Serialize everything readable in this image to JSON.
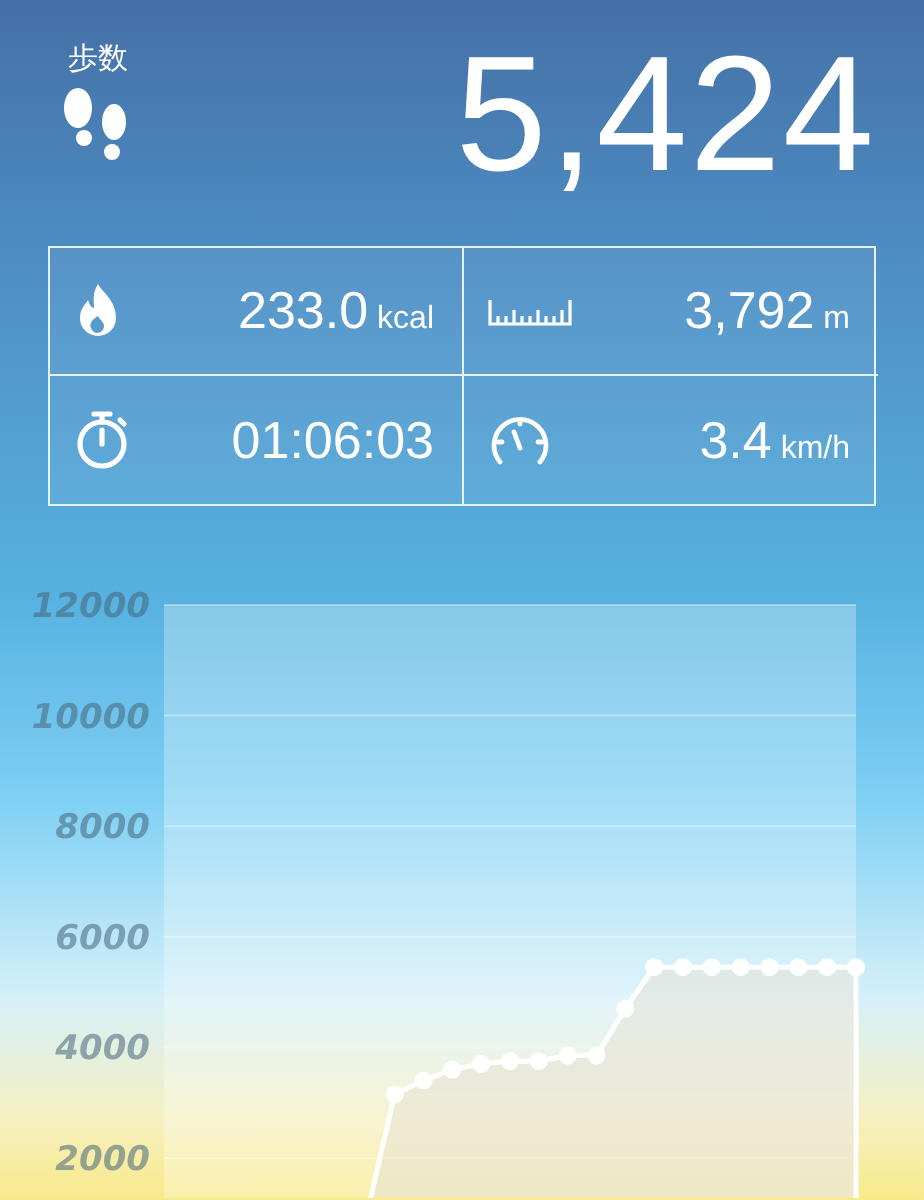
{
  "header": {
    "label": "歩数",
    "steps": "5,424"
  },
  "stats": [
    {
      "kind": "calories",
      "value": "233.0",
      "unit": "kcal"
    },
    {
      "kind": "distance",
      "value": "3,792",
      "unit": "m"
    },
    {
      "kind": "duration",
      "value": "01:06:03"
    },
    {
      "kind": "speed",
      "value": "3.4",
      "unit": "km/h"
    }
  ],
  "chart": {
    "chart_data": {
      "type": "area",
      "grid": true,
      "ylim": [
        0,
        12000
      ],
      "yticks": [
        2000,
        4000,
        6000,
        8000,
        10000,
        12000
      ],
      "series": [
        {
          "color": "#ffffff",
          "values": [
            null,
            null,
            null,
            null,
            null,
            null,
            null,
            900,
            3150,
            3400,
            3600,
            3700,
            3750,
            3750,
            3850,
            3850,
            4700,
            5450,
            5450,
            5450,
            5450,
            5450,
            5450,
            5450,
            5450
          ]
        }
      ]
    }
  }
}
